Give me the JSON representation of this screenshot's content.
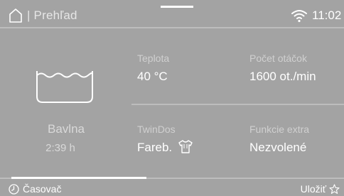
{
  "header": {
    "title": "| Prehľad",
    "time": "11:02",
    "icons": [
      "home-icon",
      "wifi-icon"
    ]
  },
  "program": {
    "icon": "tub-icon",
    "name": "Bavlna",
    "duration": "2:39  h"
  },
  "settings": [
    {
      "label": "Teplota",
      "value": "40 °C"
    },
    {
      "label": "Počet otáčok",
      "value": "1600 ot./min"
    },
    {
      "label": "TwinDos",
      "value": "Fareb.",
      "icon": "shirt-icon"
    },
    {
      "label": "Funkcie extra",
      "value": "Nezvolené"
    }
  ],
  "progress": {
    "fraction": 0.42
  },
  "footer": {
    "timer_label": "Časovač",
    "timer_icon": "clock-icon",
    "save_label": "Uložiť",
    "save_icon": "star-icon"
  }
}
